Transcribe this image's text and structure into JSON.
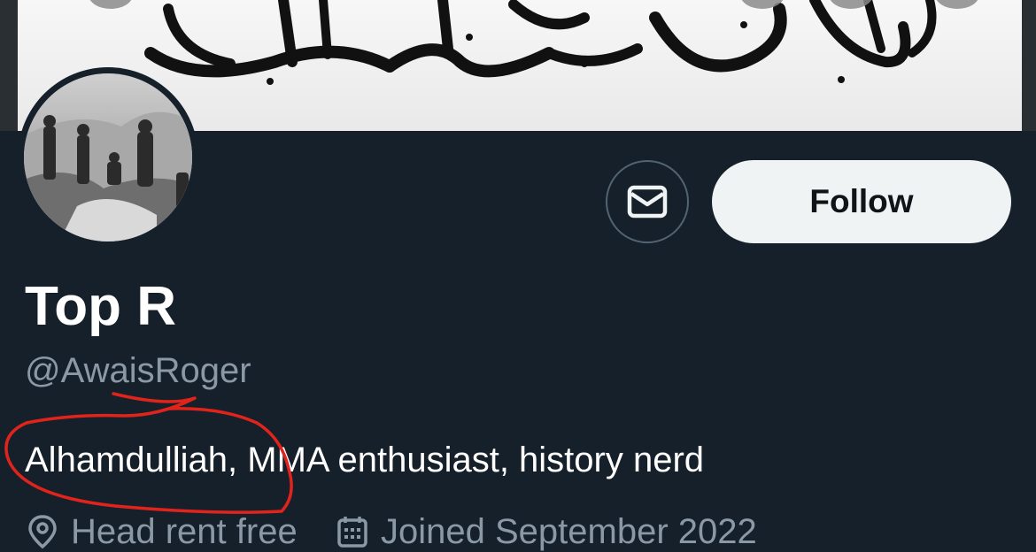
{
  "profile": {
    "display_name": "Top R",
    "handle": "@AwaisRoger",
    "bio": "Alhamdulliah, MMA enthusiast, history nerd",
    "location": "Head rent free",
    "joined": "Joined September 2022"
  },
  "actions": {
    "follow_label": "Follow",
    "message_icon": "envelope-icon"
  },
  "icons": {
    "location": "location-pin-icon",
    "calendar": "calendar-icon"
  },
  "colors": {
    "background": "#15202b",
    "primary_text": "#ffffff",
    "secondary_text": "#8b98a5",
    "follow_button_bg": "#eff3f4",
    "annotation": "#e0241b"
  }
}
